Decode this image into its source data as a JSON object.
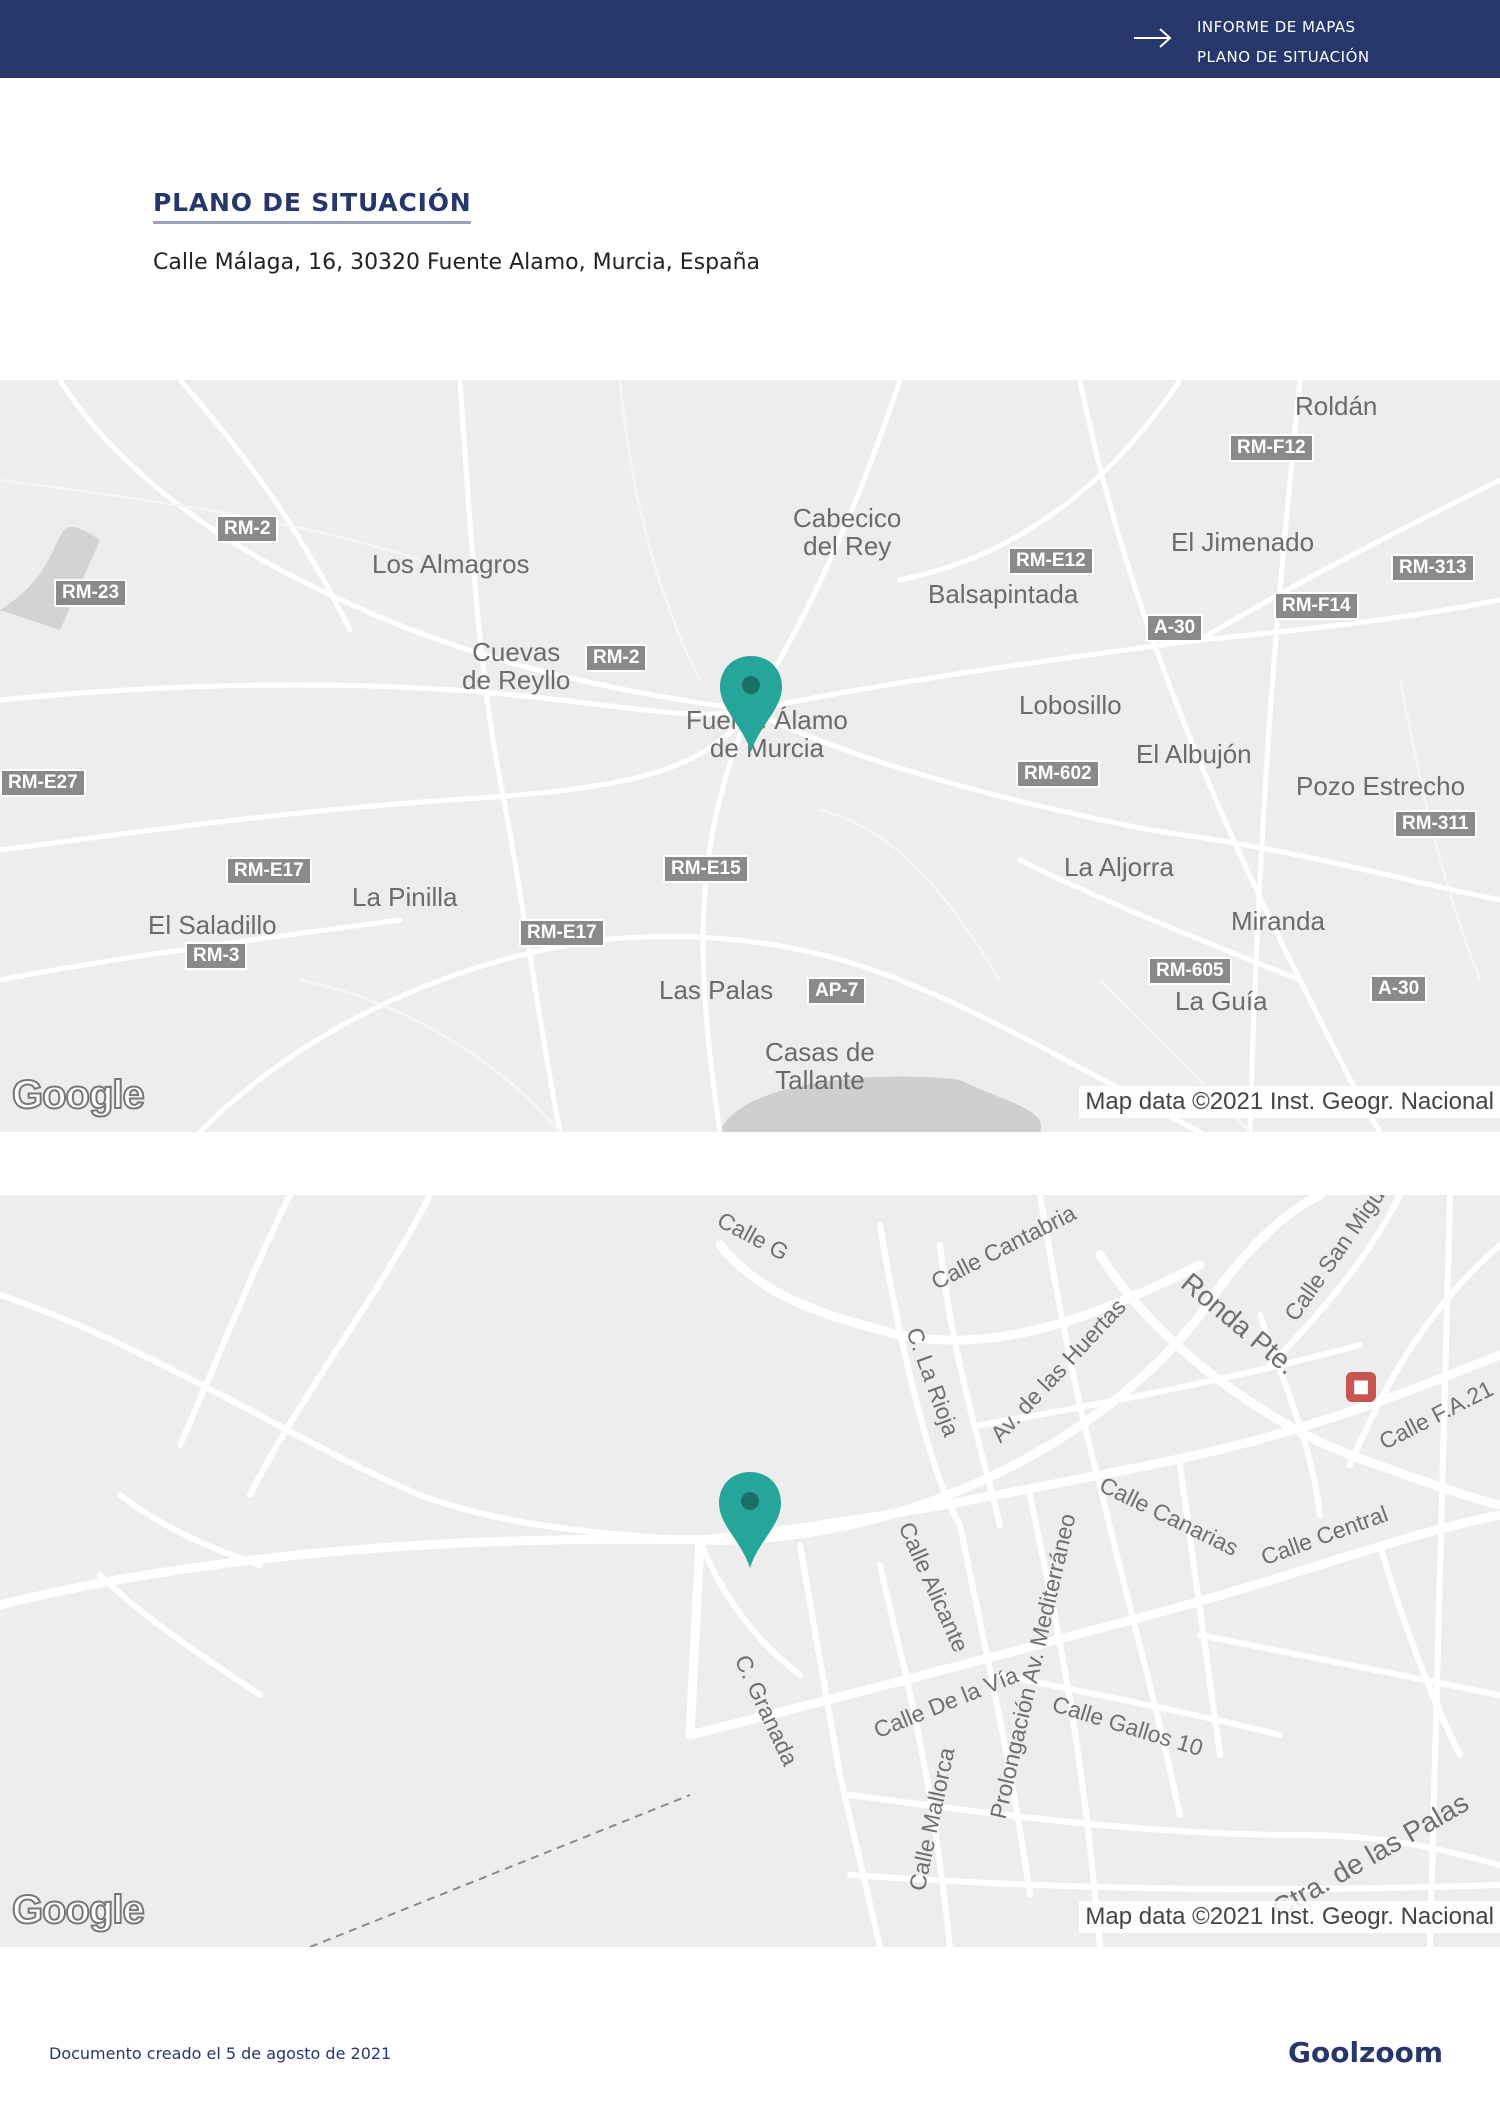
{
  "header": {
    "breadcrumb_1": "INFORME DE MAPAS",
    "breadcrumb_2": "PLANO DE SITUACIÓN",
    "arrow_icon": "arrow-right-icon",
    "bg_color": "#27366b"
  },
  "section": {
    "title": "PLANO DE SITUACIÓN",
    "address": "Calle Málaga, 16, 30320 Fuente Alamo, Murcia, España"
  },
  "map_overview": {
    "places": {
      "roldan": "Roldán",
      "cabecico": "Cabecico\ndel Rey",
      "los_almagros": "Los Almagros",
      "el_jimenado": "El Jimenado",
      "balsapintada": "Balsapintada",
      "cuevas": "Cuevas\nde Reyllo",
      "fuente_alamo": "Fuente Álamo\nde Murcia",
      "lobosillo": "Lobosillo",
      "el_albujon": "El Albujón",
      "pozo_estrecho": "Pozo Estrecho",
      "la_aljorra": "La Aljorra",
      "la_pinilla": "La Pinilla",
      "el_saladillo": "El Saladillo",
      "miranda": "Miranda",
      "las_palas": "Las Palas",
      "la_guia": "La Guía",
      "casas_tallante": "Casas de\nTallante"
    },
    "shields": {
      "rm_f12": "RM-F12",
      "rm_2a": "RM-2",
      "rm_23": "RM-23",
      "rm_e12": "RM-E12",
      "rm_313": "RM-313",
      "rm_f14": "RM-F14",
      "a_30a": "A-30",
      "rm_2b": "RM-2",
      "rm_e27": "RM-E27",
      "rm_602": "RM-602",
      "rm_311": "RM-311",
      "rm_e17a": "RM-E17",
      "rm_e15": "RM-E15",
      "rm_3": "RM-3",
      "rm_e17b": "RM-E17",
      "rm_605": "RM-605",
      "ap_7": "AP-7",
      "a_30b": "A-30"
    },
    "google_logo": "Google",
    "attribution": "Map data ©2021 Inst. Geogr. Nacional",
    "pin_color": "#26a69a"
  },
  "map_detail": {
    "streets": {
      "calle_g": "Calle G",
      "calle_cantabria": "Calle Cantabria",
      "calle_san_miguel": "Calle San Migu",
      "ronda_pte": "Ronda Pte.",
      "c_la_rioja": "C. La Rioja",
      "av_huertas": "Av. de las Huertas",
      "calle_fa21": "Calle F.A.21",
      "calle_canarias": "Calle Canarias",
      "calle_central": "Calle Central",
      "calle_alicante": "Calle Alicante",
      "prolongacion": "Prolongación Av. Mediterráneo",
      "c_granada": "C. Granada",
      "calle_de_la_via": "Calle De la Vía",
      "calle_gallos": "Calle Gallos 10",
      "calle_mallorca": "Calle Mallorca",
      "ctra_palas": "Ctra. de las Palas"
    },
    "google_logo": "Google",
    "attribution": "Map data ©2021 Inst. Geogr. Nacional",
    "bus_icon": "bus-stop-icon",
    "pin_color": "#26a69a"
  },
  "footer": {
    "created": "Documento creado el 5 de agosto de 2021",
    "brand": "Goolzoom"
  }
}
